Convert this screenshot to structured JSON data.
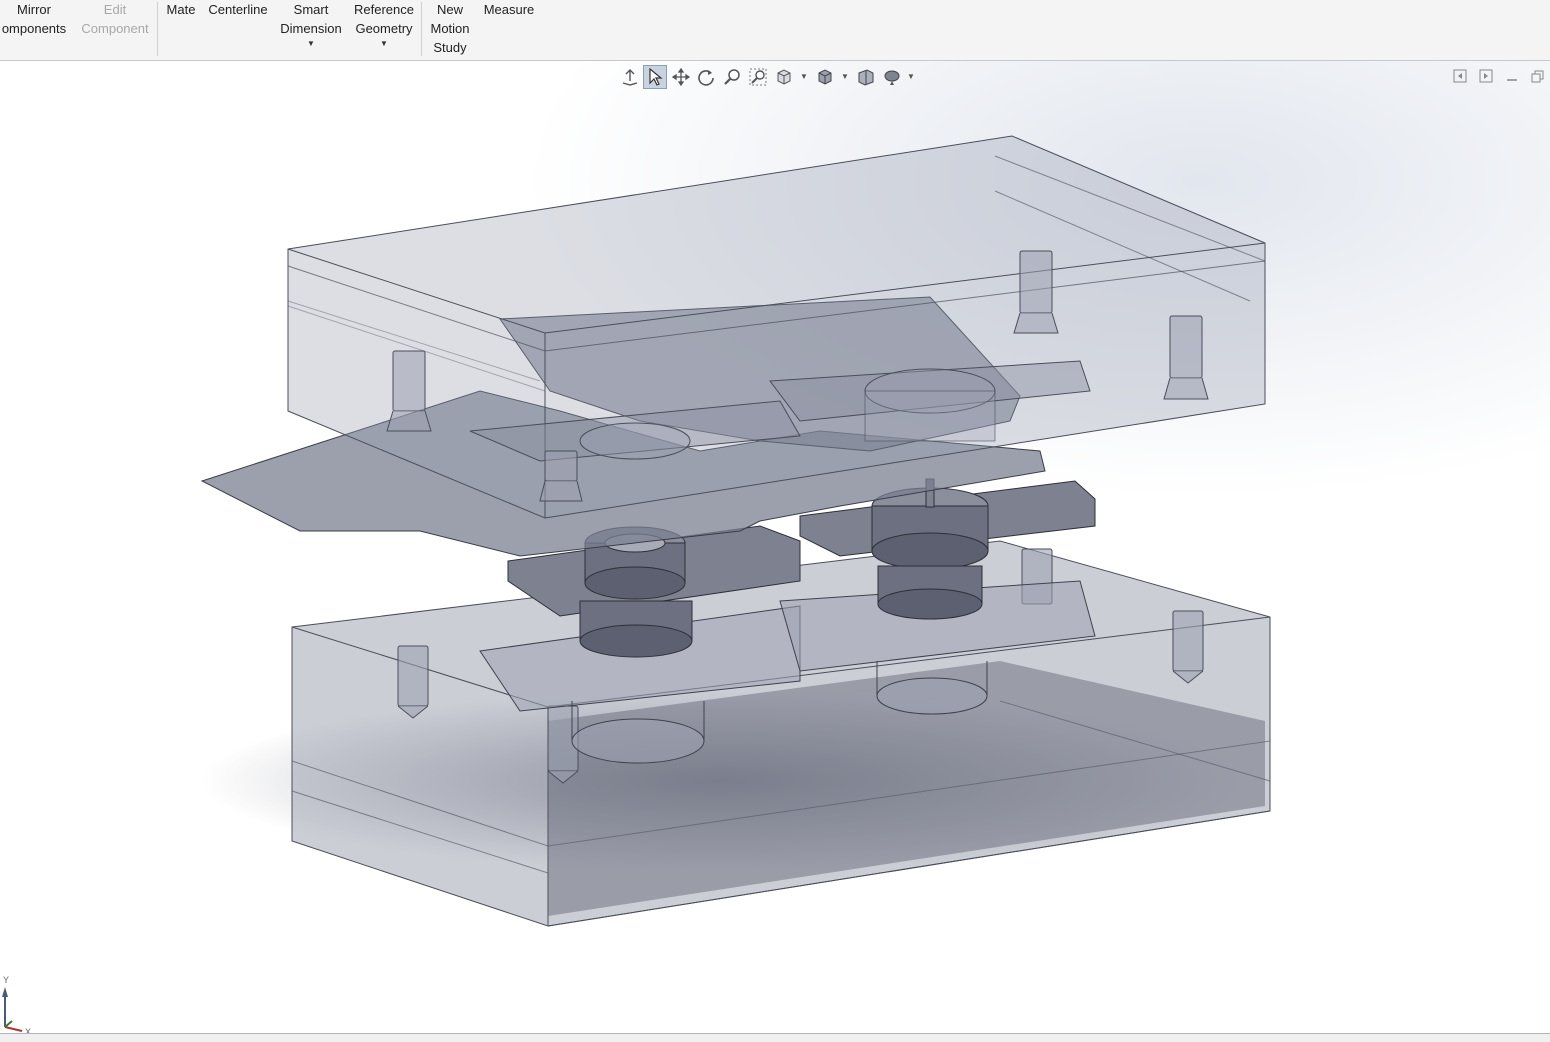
{
  "ribbon": {
    "buttons": [
      {
        "id": "mirror-components",
        "lines": [
          "Mirror",
          "omponents"
        ],
        "enabled": true
      },
      {
        "id": "edit-component",
        "lines": [
          "Edit",
          "Component"
        ],
        "enabled": false
      },
      {
        "id": "mate",
        "lines": [
          "Mate"
        ],
        "enabled": true
      },
      {
        "id": "centerline",
        "lines": [
          "Centerline"
        ],
        "enabled": true
      },
      {
        "id": "smart-dimension",
        "lines": [
          "Smart",
          "Dimension"
        ],
        "enabled": true,
        "dropdown": true
      },
      {
        "id": "reference-geometry",
        "lines": [
          "Reference",
          "Geometry"
        ],
        "enabled": true,
        "dropdown": true
      },
      {
        "id": "new-motion-study",
        "lines": [
          "New",
          "Motion",
          "Study"
        ],
        "enabled": true
      },
      {
        "id": "measure",
        "lines": [
          "Measure"
        ],
        "enabled": true
      }
    ]
  },
  "heads_up_toolbar": {
    "icons": [
      "normal-to-icon",
      "select-icon",
      "pan-icon",
      "rotate-icon",
      "zoom-icon",
      "zoom-to-area-icon",
      "view-orientation-icon",
      "display-style-icon",
      "section-view-icon",
      "appearance-icon"
    ]
  },
  "triad": {
    "y_label": "Y",
    "x_label": "X"
  },
  "colors": {
    "ribbon_bg": "#f4f4f4",
    "steel": "#8e93a5",
    "part_dark": "#5c6070",
    "part_mid": "#8a8e9d"
  }
}
